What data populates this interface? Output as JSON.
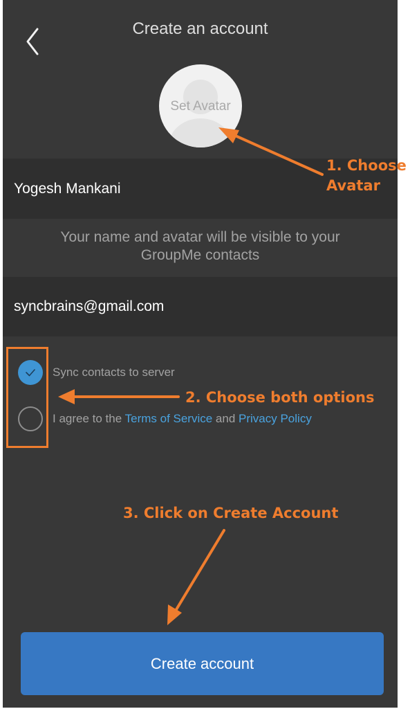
{
  "header": {
    "title": "Create an account"
  },
  "avatar": {
    "label": "Set Avatar"
  },
  "form": {
    "name_value": "Yogesh Mankani",
    "notice_line1": "Your name and avatar will be visible to your",
    "notice_line2": "GroupMe contacts",
    "email_value": "syncbrains@gmail.com"
  },
  "options": {
    "sync_label": "Sync contacts to server",
    "sync_checked": true,
    "terms_prefix": "I agree to the ",
    "terms_link": "Terms of Service",
    "terms_and": " and ",
    "privacy_link": "Privacy Policy",
    "terms_checked": false
  },
  "actions": {
    "create_label": "Create account"
  },
  "annotations": {
    "step1_line1": "1. Choose",
    "step1_line2": "Avatar",
    "step2": "2. Choose both options",
    "step3": "3. Click on Create Account"
  },
  "icons": {
    "back": "chevron-left-icon",
    "avatar_placeholder": "person-silhouette-icon",
    "check": "checkmark-icon"
  },
  "colors": {
    "background": "#383838",
    "field_background": "#2f2f2f",
    "accent_blue": "#3f95d4",
    "button_blue": "#3778c3",
    "link_blue": "#4aa3df",
    "annotation_orange": "#ef7d2e"
  }
}
